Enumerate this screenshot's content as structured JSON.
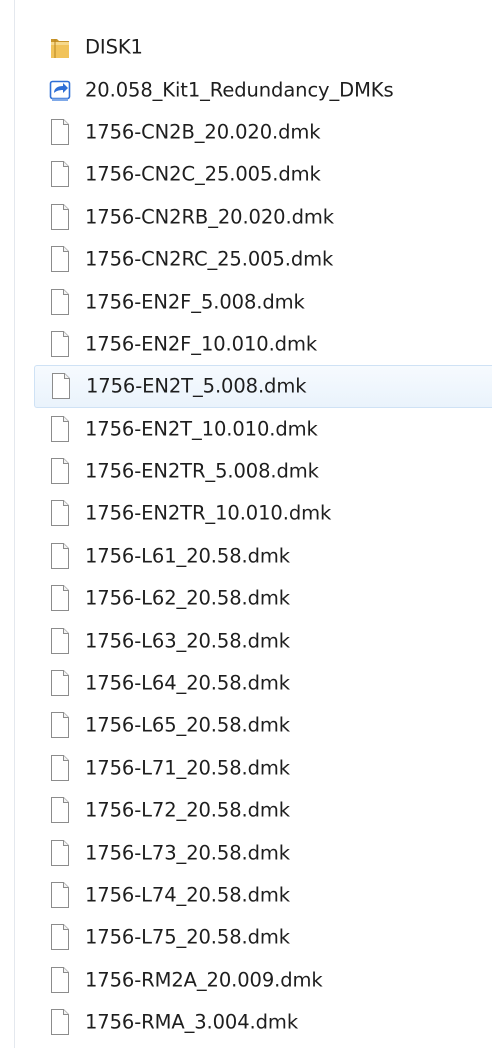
{
  "explorer": {
    "items": [
      {
        "name": "DISK1",
        "type": "folder",
        "icon": "folder-icon"
      },
      {
        "name": "20.058_Kit1_Redundancy_DMKs",
        "type": "shortcut",
        "icon": "shortcut-icon"
      },
      {
        "name": "1756-CN2B_20.020.dmk",
        "type": "file",
        "icon": "file-icon"
      },
      {
        "name": "1756-CN2C_25.005.dmk",
        "type": "file",
        "icon": "file-icon"
      },
      {
        "name": "1756-CN2RB_20.020.dmk",
        "type": "file",
        "icon": "file-icon"
      },
      {
        "name": "1756-CN2RC_25.005.dmk",
        "type": "file",
        "icon": "file-icon"
      },
      {
        "name": "1756-EN2F_5.008.dmk",
        "type": "file",
        "icon": "file-icon"
      },
      {
        "name": "1756-EN2F_10.010.dmk",
        "type": "file",
        "icon": "file-icon"
      },
      {
        "name": "1756-EN2T_5.008.dmk",
        "type": "file",
        "icon": "file-icon",
        "selected": true
      },
      {
        "name": "1756-EN2T_10.010.dmk",
        "type": "file",
        "icon": "file-icon"
      },
      {
        "name": "1756-EN2TR_5.008.dmk",
        "type": "file",
        "icon": "file-icon"
      },
      {
        "name": "1756-EN2TR_10.010.dmk",
        "type": "file",
        "icon": "file-icon"
      },
      {
        "name": "1756-L61_20.58.dmk",
        "type": "file",
        "icon": "file-icon"
      },
      {
        "name": "1756-L62_20.58.dmk",
        "type": "file",
        "icon": "file-icon"
      },
      {
        "name": "1756-L63_20.58.dmk",
        "type": "file",
        "icon": "file-icon"
      },
      {
        "name": "1756-L64_20.58.dmk",
        "type": "file",
        "icon": "file-icon"
      },
      {
        "name": "1756-L65_20.58.dmk",
        "type": "file",
        "icon": "file-icon"
      },
      {
        "name": "1756-L71_20.58.dmk",
        "type": "file",
        "icon": "file-icon"
      },
      {
        "name": "1756-L72_20.58.dmk",
        "type": "file",
        "icon": "file-icon"
      },
      {
        "name": "1756-L73_20.58.dmk",
        "type": "file",
        "icon": "file-icon"
      },
      {
        "name": "1756-L74_20.58.dmk",
        "type": "file",
        "icon": "file-icon"
      },
      {
        "name": "1756-L75_20.58.dmk",
        "type": "file",
        "icon": "file-icon"
      },
      {
        "name": "1756-RM2A_20.009.dmk",
        "type": "file",
        "icon": "file-icon"
      },
      {
        "name": "1756-RMA_3.004.dmk",
        "type": "file",
        "icon": "file-icon"
      }
    ],
    "colors": {
      "text": "#1e1e1e",
      "selection_bg": "#eaf3fc",
      "selection_border": "#cfe2f5",
      "folder": "#e8b84a",
      "shortcut": "#2f6fd6"
    }
  }
}
